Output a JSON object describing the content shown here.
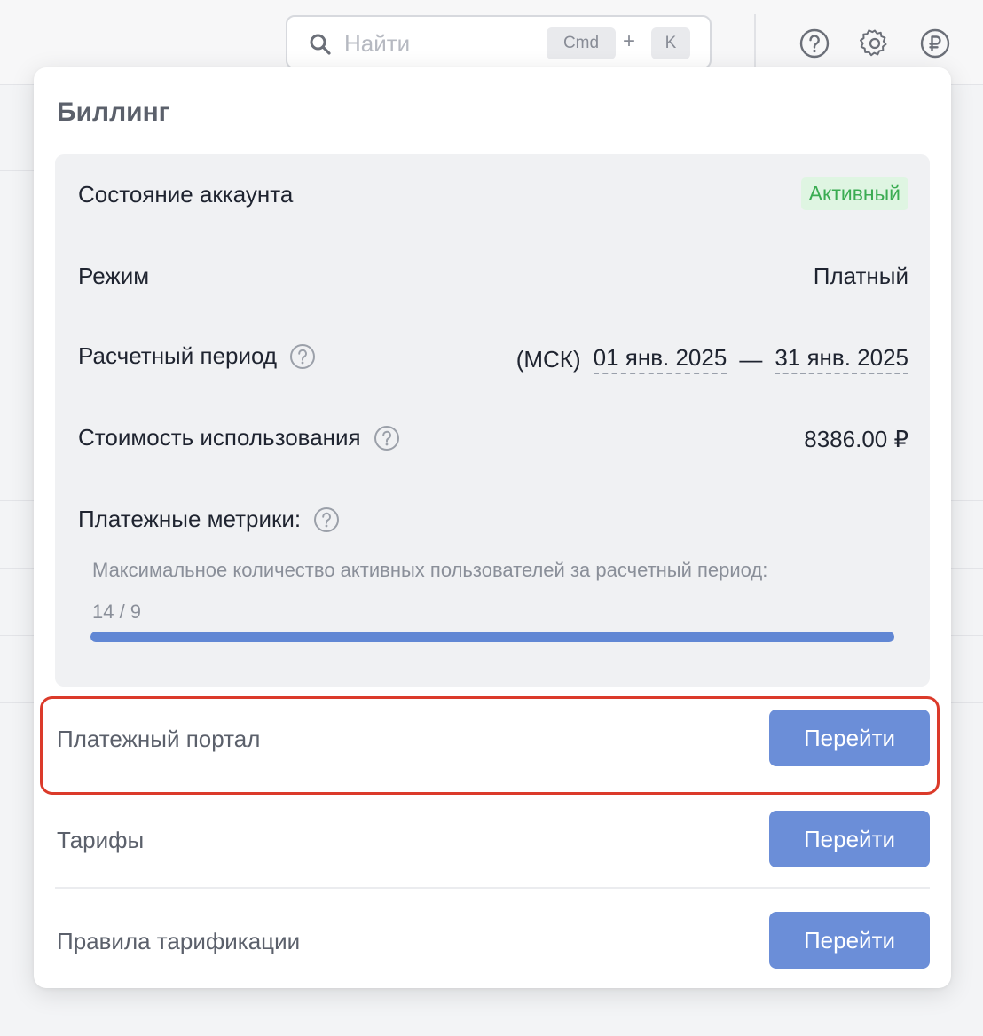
{
  "topbar": {
    "search_placeholder": "Найти",
    "shortcut_modifier": "Cmd",
    "shortcut_plus": "+",
    "shortcut_key": "K",
    "icons": [
      "help-icon",
      "gear-icon",
      "ruble-icon"
    ]
  },
  "billing": {
    "title": "Биллинг",
    "account_state_label": "Состояние аккаунта",
    "account_state_value": "Активный",
    "mode_label": "Режим",
    "mode_value": "Платный",
    "period_label": "Расчетный период",
    "period_tz": "(МСК)",
    "period_start": "01 янв. 2025",
    "period_separator": "—",
    "period_end": "31 янв. 2025",
    "cost_label": "Стоимость использования",
    "cost_value": "8386.00 ₽",
    "metrics_label": "Платежные метрики:",
    "metrics_desc": "Максимальное количество активных пользователей за расчетный период:",
    "metrics_value": "14 / 9",
    "metrics_fill_fraction": 1.0
  },
  "links": [
    {
      "label": "Платежный портал",
      "button": "Перейти"
    },
    {
      "label": "Тарифы",
      "button": "Перейти"
    },
    {
      "label": "Правила тарификации",
      "button": "Перейти"
    }
  ],
  "colors": {
    "accent": "#6b8ed8",
    "progress": "#6187d4",
    "active_badge_bg": "#dff5e2",
    "active_badge_text": "#3bac52",
    "highlight": "#db3a2a"
  }
}
